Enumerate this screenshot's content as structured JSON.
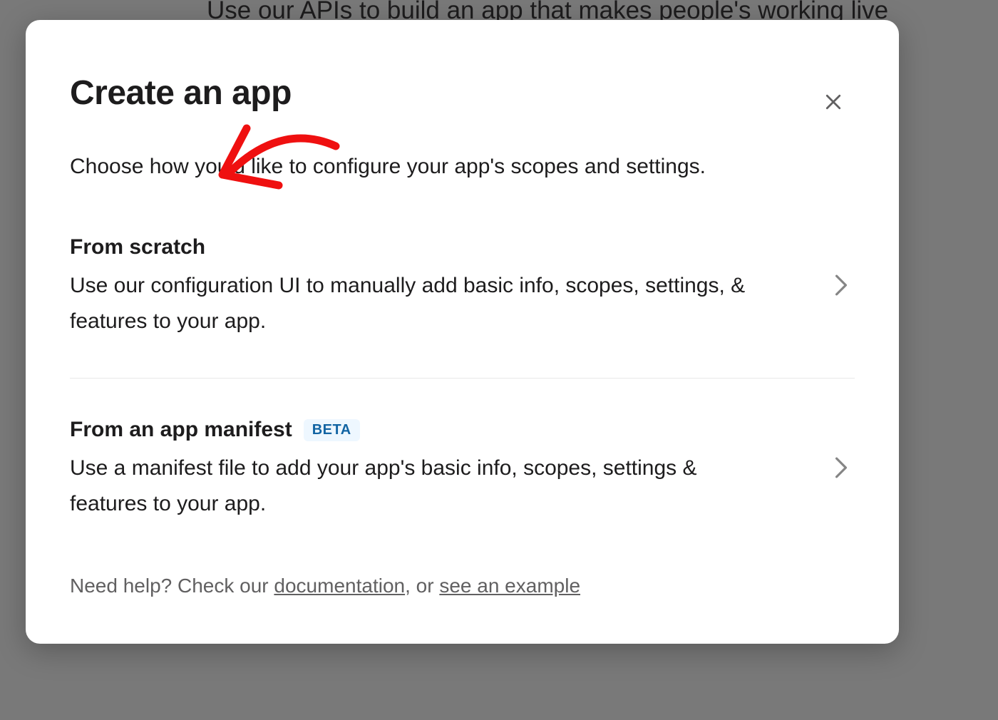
{
  "backdrop": {
    "text": "Use our APIs to build an app that makes people's working live"
  },
  "modal": {
    "title": "Create an app",
    "subtitle": "Choose how you'd like to configure your app's scopes and settings.",
    "options": [
      {
        "title": "From scratch",
        "desc": "Use our configuration UI to manually add basic info, scopes, settings, & features to your app.",
        "badge": null
      },
      {
        "title": "From an app manifest",
        "desc": "Use a manifest file to add your app's basic info, scopes, settings & features to your app.",
        "badge": "BETA"
      }
    ],
    "help": {
      "prefix": "Need help? Check our ",
      "doc_label": "documentation",
      "middle": ", or ",
      "example_label": "see an example"
    }
  }
}
